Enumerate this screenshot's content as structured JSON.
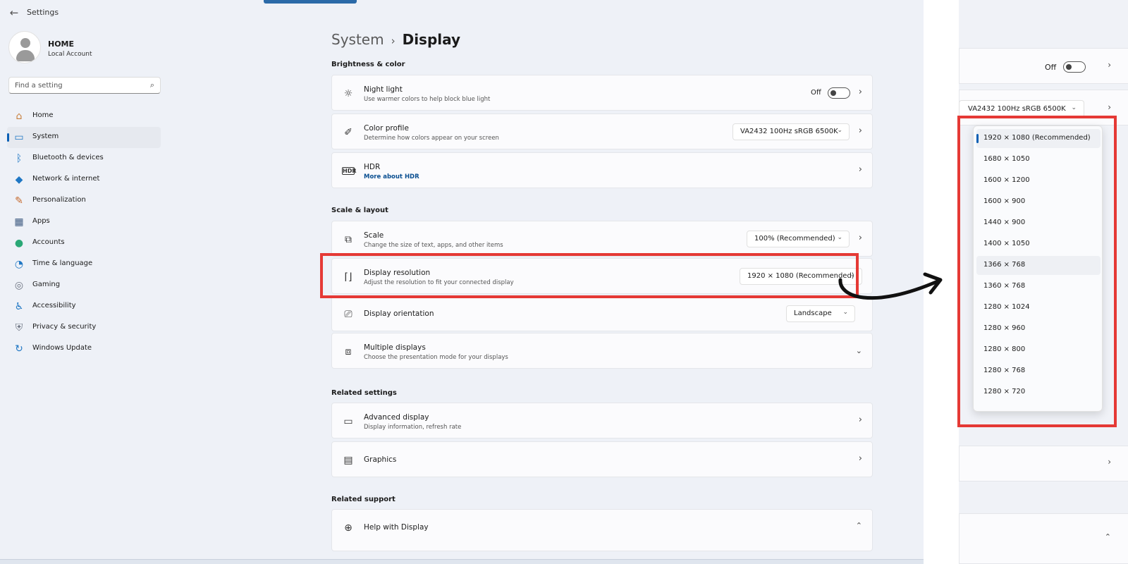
{
  "app": {
    "title": "Settings"
  },
  "profile": {
    "name": "HOME",
    "type": "Local Account"
  },
  "search": {
    "placeholder": "Find a setting"
  },
  "nav": [
    {
      "label": "Home",
      "icon": "home-icon",
      "glyph": "⌂",
      "color": "#c87f3c"
    },
    {
      "label": "System",
      "icon": "system-icon",
      "glyph": "▭",
      "color": "#1f77c4"
    },
    {
      "label": "Bluetooth & devices",
      "icon": "bluetooth-icon",
      "glyph": "ᛒ",
      "color": "#1f77c4"
    },
    {
      "label": "Network & internet",
      "icon": "wifi-icon",
      "glyph": "◆",
      "color": "#1f77c4"
    },
    {
      "label": "Personalization",
      "icon": "brush-icon",
      "glyph": "✎",
      "color": "#c56a2d"
    },
    {
      "label": "Apps",
      "icon": "apps-icon",
      "glyph": "▦",
      "color": "#3d5a80"
    },
    {
      "label": "Accounts",
      "icon": "accounts-icon",
      "glyph": "●",
      "color": "#2aa876"
    },
    {
      "label": "Time & language",
      "icon": "globe-clock-icon",
      "glyph": "◔",
      "color": "#1f77c4"
    },
    {
      "label": "Gaming",
      "icon": "gamepad-icon",
      "glyph": "◎",
      "color": "#6b7280"
    },
    {
      "label": "Accessibility",
      "icon": "accessibility-icon",
      "glyph": "♿",
      "color": "#1f77c4"
    },
    {
      "label": "Privacy & security",
      "icon": "shield-icon",
      "glyph": "⛨",
      "color": "#6b7280"
    },
    {
      "label": "Windows Update",
      "icon": "update-icon",
      "glyph": "↻",
      "color": "#1f77c4"
    }
  ],
  "breadcrumb": {
    "parent": "System",
    "separator": "›",
    "current": "Display"
  },
  "sections": {
    "brightness": "Brightness & color",
    "scale_layout": "Scale & layout",
    "related_settings": "Related settings",
    "related_support": "Related support"
  },
  "cards": {
    "night_light": {
      "title": "Night light",
      "subtitle": "Use warmer colors to help block blue light",
      "state": "Off"
    },
    "color_profile": {
      "title": "Color profile",
      "subtitle": "Determine how colors appear on your screen",
      "value": "VA2432 100Hz sRGB 6500K"
    },
    "hdr": {
      "title": "HDR",
      "link": "More about HDR"
    },
    "scale": {
      "title": "Scale",
      "subtitle": "Change the size of text, apps, and other items",
      "value": "100% (Recommended)"
    },
    "resolution": {
      "title": "Display resolution",
      "subtitle": "Adjust the resolution to fit your connected display",
      "value": "1920 × 1080 (Recommended)"
    },
    "orientation": {
      "title": "Display orientation",
      "value": "Landscape"
    },
    "multiple": {
      "title": "Multiple displays",
      "subtitle": "Choose the presentation mode for your displays"
    },
    "advanced": {
      "title": "Advanced display",
      "subtitle": "Display information, refresh rate"
    },
    "graphics": {
      "title": "Graphics"
    },
    "help": {
      "title": "Help with Display"
    }
  },
  "zoom_panel": {
    "night_light_state": "Off",
    "color_profile_value": "VA2432 100Hz sRGB 6500K"
  },
  "resolution_options": [
    "1920 × 1080 (Recommended)",
    "1680 × 1050",
    "1600 × 1200",
    "1600 × 900",
    "1440 × 900",
    "1400 × 1050",
    "1366 × 768",
    "1360 × 768",
    "1280 × 1024",
    "1280 × 960",
    "1280 × 800",
    "1280 × 768",
    "1280 × 720"
  ],
  "selected_resolution_index": 0,
  "hovered_resolution_index": 6,
  "colors": {
    "accent": "#0a5fb4",
    "highlight": "#e53935",
    "window_bg": "#eef1f7"
  }
}
